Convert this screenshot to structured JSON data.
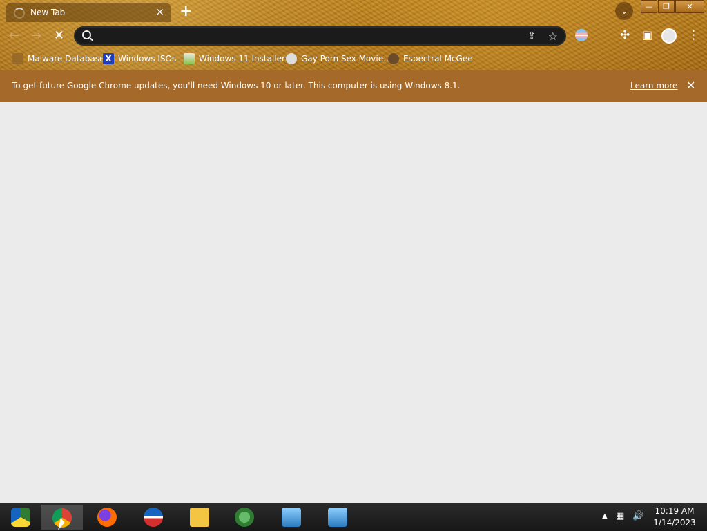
{
  "browser": {
    "tab": {
      "title": "New Tab",
      "close": "×"
    },
    "new_tab": "+",
    "window_buttons": {
      "minimize": "—",
      "restore": "❐",
      "close": "✕"
    },
    "omnibox": {
      "value": "",
      "placeholder": ""
    },
    "bookmarks": [
      {
        "label": "Malware Database",
        "icon": "folder-icon"
      },
      {
        "label": "Windows ISOs",
        "icon": "x-logo-icon"
      },
      {
        "label": "Windows 11 Installer",
        "icon": "image-icon"
      },
      {
        "label": "Gay Porn Sex Movie...",
        "icon": "site-icon"
      },
      {
        "label": "Espectral McGee",
        "icon": "avatar-icon"
      }
    ],
    "infobar": {
      "message": "To get future Google Chrome updates, you'll need Windows 10 or later. This computer is using Windows 8.1.",
      "learn_more": "Learn more",
      "close": "✕"
    }
  },
  "taskbar": {
    "apps": [
      {
        "name": "chromium",
        "color": "#2e7d32"
      },
      {
        "name": "google-chrome",
        "color": "#1a73e8"
      },
      {
        "name": "firefox",
        "color": "#ff6d00"
      },
      {
        "name": "obama-logo",
        "color": "#1565c0"
      },
      {
        "name": "file-explorer",
        "color": "#f4c542"
      },
      {
        "name": "network-app",
        "color": "#2e7d32"
      },
      {
        "name": "setup-app-1",
        "color": "#5ab0e6"
      },
      {
        "name": "setup-app-2",
        "color": "#5ab0e6"
      }
    ],
    "clock": {
      "time": "10:19 AM",
      "date": "1/14/2023"
    }
  }
}
